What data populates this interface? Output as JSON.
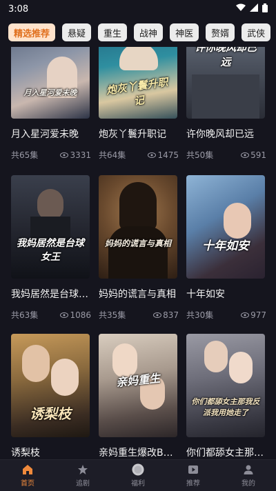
{
  "status_bar": {
    "time": "3:08"
  },
  "categories": [
    {
      "label": "精选推荐",
      "active": true
    },
    {
      "label": "悬疑",
      "active": false
    },
    {
      "label": "重生",
      "active": false
    },
    {
      "label": "战神",
      "active": false
    },
    {
      "label": "神医",
      "active": false
    },
    {
      "label": "赘婿",
      "active": false
    },
    {
      "label": "武侠",
      "active": false
    }
  ],
  "dramas": [
    {
      "title": "月入星河爱未晚",
      "episodes": "共65集",
      "views": "3331",
      "poster_text": "月入星河爱未晚"
    },
    {
      "title": "炮灰丫鬟升职记",
      "episodes": "共64集",
      "views": "1475",
      "poster_text": "炮灰丫鬟升职记"
    },
    {
      "title": "许你晚风却已远",
      "episodes": "共50集",
      "views": "591",
      "poster_text": "许你晚风却已远"
    },
    {
      "title": "我妈居然是台球女王",
      "episodes": "共63集",
      "views": "1086",
      "poster_text": "我妈居然是台球女王"
    },
    {
      "title": "妈妈的谎言与真相",
      "episodes": "共35集",
      "views": "837",
      "poster_text": "妈妈的谎言与真相"
    },
    {
      "title": "十年如安",
      "episodes": "共30集",
      "views": "977",
      "poster_text": "十年如安"
    },
    {
      "title": "诱梨枝",
      "episodes": "",
      "views": "",
      "poster_text": "诱梨枝"
    },
    {
      "title": "亲妈重生爆改B…",
      "episodes": "",
      "views": "",
      "poster_text": "亲妈重生"
    },
    {
      "title": "你们都舔女主那…",
      "episodes": "",
      "views": "",
      "poster_text": "你们都舔女主那我反派我用她走了"
    }
  ],
  "nav": [
    {
      "label": "首页",
      "icon": "home-icon",
      "active": true
    },
    {
      "label": "追剧",
      "icon": "star-icon",
      "active": false
    },
    {
      "label": "福利",
      "icon": "gift-circle-icon",
      "active": false
    },
    {
      "label": "推荐",
      "icon": "play-icon",
      "active": false
    },
    {
      "label": "我的",
      "icon": "person-icon",
      "active": false
    }
  ],
  "colors": {
    "accent": "#f08a3c",
    "background": "#15151e",
    "chip_active_bg": "#ffe3cc"
  }
}
